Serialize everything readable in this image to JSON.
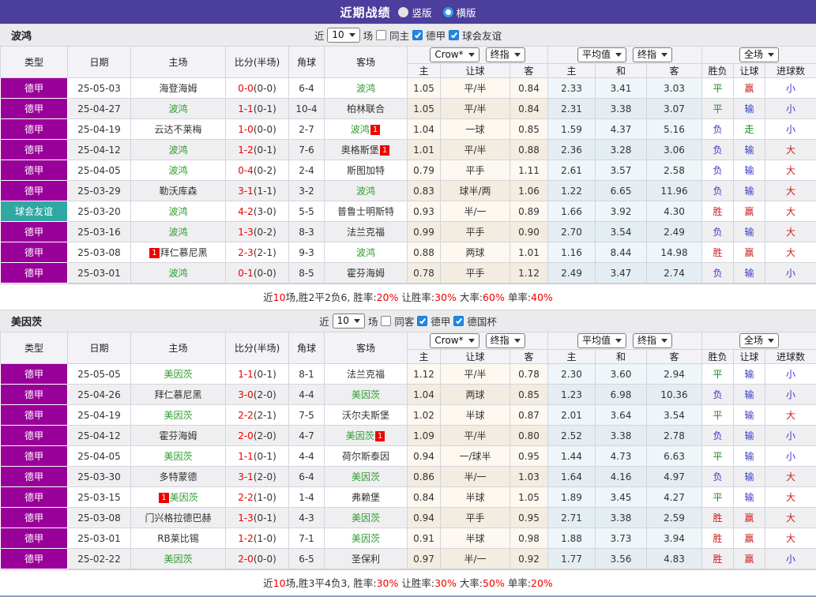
{
  "title_bar": {
    "title": "近期战绩",
    "radios": [
      {
        "label": "竖版",
        "checked": false
      },
      {
        "label": "横版",
        "checked": true
      }
    ]
  },
  "table_header": {
    "static_cols": [
      "类型",
      "日期",
      "主场",
      "比分(半场)",
      "角球",
      "客场"
    ],
    "selects": {
      "company": "Crow*",
      "stage": "终指",
      "average": "平均值",
      "average_stage": "终指",
      "scope": "全场"
    },
    "odds_cols": [
      "主",
      "让球",
      "客"
    ],
    "avg_cols": [
      "主",
      "和",
      "客"
    ],
    "result_cols": [
      "胜负",
      "让球",
      "进球数"
    ]
  },
  "redcard_badge": "1",
  "sections": [
    {
      "team": "波鸿",
      "filter": {
        "near": "近",
        "count": "10",
        "games": "场",
        "same": {
          "label": "同主",
          "checked": false
        },
        "leagues": [
          {
            "label": "德甲",
            "checked": true
          },
          {
            "label": "球会友谊",
            "checked": true
          }
        ]
      },
      "rows": [
        {
          "league": "德甲",
          "badge": "purple",
          "date": "25-05-03",
          "home": {
            "name": "海登海姆",
            "green": false,
            "rc": false
          },
          "score": "0-0",
          "half": "(0-0)",
          "corner": "6-4",
          "away": {
            "name": "波鸿",
            "green": true,
            "rc": false
          },
          "odds": [
            "1.05",
            "平/半",
            "0.84",
            "2.33",
            "3.41",
            "3.03"
          ],
          "results": [
            [
              "平",
              "g"
            ],
            [
              "赢",
              "r"
            ],
            [
              "小",
              "b"
            ]
          ]
        },
        {
          "league": "德甲",
          "badge": "purple",
          "date": "25-04-27",
          "home": {
            "name": "波鸿",
            "green": true,
            "rc": false
          },
          "score": "1-1",
          "half": "(0-1)",
          "corner": "10-4",
          "away": {
            "name": "柏林联合",
            "green": false,
            "rc": false
          },
          "odds": [
            "1.05",
            "平/半",
            "0.84",
            "2.31",
            "3.38",
            "3.07"
          ],
          "results": [
            [
              "平",
              "g"
            ],
            [
              "输",
              "b"
            ],
            [
              "小",
              "b"
            ]
          ]
        },
        {
          "league": "德甲",
          "badge": "purple",
          "date": "25-04-19",
          "home": {
            "name": "云达不莱梅",
            "green": false,
            "rc": false
          },
          "score": "1-0",
          "half": "(0-0)",
          "corner": "2-7",
          "away": {
            "name": "波鸿",
            "green": true,
            "rc": true
          },
          "odds": [
            "1.04",
            "一球",
            "0.85",
            "1.59",
            "4.37",
            "5.16"
          ],
          "results": [
            [
              "负",
              "b"
            ],
            [
              "走",
              "g"
            ],
            [
              "小",
              "b"
            ]
          ]
        },
        {
          "league": "德甲",
          "badge": "purple",
          "date": "25-04-12",
          "home": {
            "name": "波鸿",
            "green": true,
            "rc": false
          },
          "score": "1-2",
          "half": "(0-1)",
          "corner": "7-6",
          "away": {
            "name": "奥格斯堡",
            "green": false,
            "rc": true
          },
          "odds": [
            "1.01",
            "平/半",
            "0.88",
            "2.36",
            "3.28",
            "3.06"
          ],
          "results": [
            [
              "负",
              "b"
            ],
            [
              "输",
              "b"
            ],
            [
              "大",
              "r"
            ]
          ]
        },
        {
          "league": "德甲",
          "badge": "purple",
          "date": "25-04-05",
          "home": {
            "name": "波鸿",
            "green": true,
            "rc": false
          },
          "score": "0-4",
          "half": "(0-2)",
          "corner": "2-4",
          "away": {
            "name": "斯图加特",
            "green": false,
            "rc": false
          },
          "odds": [
            "0.79",
            "平手",
            "1.11",
            "2.61",
            "3.57",
            "2.58"
          ],
          "results": [
            [
              "负",
              "b"
            ],
            [
              "输",
              "b"
            ],
            [
              "大",
              "r"
            ]
          ]
        },
        {
          "league": "德甲",
          "badge": "purple",
          "date": "25-03-29",
          "home": {
            "name": "勒沃库森",
            "green": false,
            "rc": false
          },
          "score": "3-1",
          "half": "(1-1)",
          "corner": "3-2",
          "away": {
            "name": "波鸿",
            "green": true,
            "rc": false
          },
          "odds": [
            "0.83",
            "球半/两",
            "1.06",
            "1.22",
            "6.65",
            "11.96"
          ],
          "results": [
            [
              "负",
              "b"
            ],
            [
              "输",
              "b"
            ],
            [
              "大",
              "r"
            ]
          ]
        },
        {
          "league": "球会友谊",
          "badge": "teal",
          "date": "25-03-20",
          "home": {
            "name": "波鸿",
            "green": true,
            "rc": false
          },
          "score": "4-2",
          "half": "(3-0)",
          "corner": "5-5",
          "away": {
            "name": "普鲁士明斯特",
            "green": false,
            "rc": false
          },
          "odds": [
            "0.93",
            "半/一",
            "0.89",
            "1.66",
            "3.92",
            "4.30"
          ],
          "results": [
            [
              "胜",
              "r"
            ],
            [
              "赢",
              "r"
            ],
            [
              "大",
              "r"
            ]
          ]
        },
        {
          "league": "德甲",
          "badge": "purple",
          "date": "25-03-16",
          "home": {
            "name": "波鸿",
            "green": true,
            "rc": false
          },
          "score": "1-3",
          "half": "(0-2)",
          "corner": "8-3",
          "away": {
            "name": "法兰克福",
            "green": false,
            "rc": false
          },
          "odds": [
            "0.99",
            "平手",
            "0.90",
            "2.70",
            "3.54",
            "2.49"
          ],
          "results": [
            [
              "负",
              "b"
            ],
            [
              "输",
              "b"
            ],
            [
              "大",
              "r"
            ]
          ]
        },
        {
          "league": "德甲",
          "badge": "purple",
          "date": "25-03-08",
          "home": {
            "name": "拜仁慕尼黑",
            "green": false,
            "rc": true
          },
          "score": "2-3",
          "half": "(2-1)",
          "corner": "9-3",
          "away": {
            "name": "波鸿",
            "green": true,
            "rc": false
          },
          "odds": [
            "0.88",
            "两球",
            "1.01",
            "1.16",
            "8.44",
            "14.98"
          ],
          "results": [
            [
              "胜",
              "r"
            ],
            [
              "赢",
              "r"
            ],
            [
              "大",
              "r"
            ]
          ]
        },
        {
          "league": "德甲",
          "badge": "purple",
          "date": "25-03-01",
          "home": {
            "name": "波鸿",
            "green": true,
            "rc": false
          },
          "score": "0-1",
          "half": "(0-0)",
          "corner": "8-5",
          "away": {
            "name": "霍芬海姆",
            "green": false,
            "rc": false
          },
          "odds": [
            "0.78",
            "平手",
            "1.12",
            "2.49",
            "3.47",
            "2.74"
          ],
          "results": [
            [
              "负",
              "b"
            ],
            [
              "输",
              "b"
            ],
            [
              "小",
              "b"
            ]
          ]
        }
      ],
      "summary": [
        [
          "近",
          "k"
        ],
        [
          "10",
          "r"
        ],
        [
          "场,胜2平2负6, 胜率:",
          "k"
        ],
        [
          "20%",
          "r"
        ],
        [
          " 让胜率:",
          "k"
        ],
        [
          "30%",
          "r"
        ],
        [
          " 大率:",
          "k"
        ],
        [
          "60%",
          "r"
        ],
        [
          " 单率:",
          "k"
        ],
        [
          "40%",
          "r"
        ]
      ]
    },
    {
      "team": "美因茨",
      "filter": {
        "near": "近",
        "count": "10",
        "games": "场",
        "same": {
          "label": "同客",
          "checked": false
        },
        "leagues": [
          {
            "label": "德甲",
            "checked": true
          },
          {
            "label": "德国杯",
            "checked": true
          }
        ]
      },
      "rows": [
        {
          "league": "德甲",
          "badge": "purple",
          "date": "25-05-05",
          "home": {
            "name": "美因茨",
            "green": true,
            "rc": false
          },
          "score": "1-1",
          "half": "(0-1)",
          "corner": "8-1",
          "away": {
            "name": "法兰克福",
            "green": false,
            "rc": false
          },
          "odds": [
            "1.12",
            "平/半",
            "0.78",
            "2.30",
            "3.60",
            "2.94"
          ],
          "results": [
            [
              "平",
              "g"
            ],
            [
              "输",
              "b"
            ],
            [
              "小",
              "b"
            ]
          ]
        },
        {
          "league": "德甲",
          "badge": "purple",
          "date": "25-04-26",
          "home": {
            "name": "拜仁慕尼黑",
            "green": false,
            "rc": false
          },
          "score": "3-0",
          "half": "(2-0)",
          "corner": "4-4",
          "away": {
            "name": "美因茨",
            "green": true,
            "rc": false
          },
          "odds": [
            "1.04",
            "两球",
            "0.85",
            "1.23",
            "6.98",
            "10.36"
          ],
          "results": [
            [
              "负",
              "b"
            ],
            [
              "输",
              "b"
            ],
            [
              "小",
              "b"
            ]
          ]
        },
        {
          "league": "德甲",
          "badge": "purple",
          "date": "25-04-19",
          "home": {
            "name": "美因茨",
            "green": true,
            "rc": false
          },
          "score": "2-2",
          "half": "(2-1)",
          "corner": "7-5",
          "away": {
            "name": "沃尔夫斯堡",
            "green": false,
            "rc": false
          },
          "odds": [
            "1.02",
            "半球",
            "0.87",
            "2.01",
            "3.64",
            "3.54"
          ],
          "results": [
            [
              "平",
              "g"
            ],
            [
              "输",
              "b"
            ],
            [
              "大",
              "r"
            ]
          ]
        },
        {
          "league": "德甲",
          "badge": "purple",
          "date": "25-04-12",
          "home": {
            "name": "霍芬海姆",
            "green": false,
            "rc": false
          },
          "score": "2-0",
          "half": "(2-0)",
          "corner": "4-7",
          "away": {
            "name": "美因茨",
            "green": true,
            "rc": true
          },
          "odds": [
            "1.09",
            "平/半",
            "0.80",
            "2.52",
            "3.38",
            "2.78"
          ],
          "results": [
            [
              "负",
              "b"
            ],
            [
              "输",
              "b"
            ],
            [
              "小",
              "b"
            ]
          ]
        },
        {
          "league": "德甲",
          "badge": "purple",
          "date": "25-04-05",
          "home": {
            "name": "美因茨",
            "green": true,
            "rc": false
          },
          "score": "1-1",
          "half": "(0-1)",
          "corner": "4-4",
          "away": {
            "name": "荷尔斯泰因",
            "green": false,
            "rc": false
          },
          "odds": [
            "0.94",
            "一/球半",
            "0.95",
            "1.44",
            "4.73",
            "6.63"
          ],
          "results": [
            [
              "平",
              "g"
            ],
            [
              "输",
              "b"
            ],
            [
              "小",
              "b"
            ]
          ]
        },
        {
          "league": "德甲",
          "badge": "purple",
          "date": "25-03-30",
          "home": {
            "name": "多特蒙德",
            "green": false,
            "rc": false
          },
          "score": "3-1",
          "half": "(2-0)",
          "corner": "6-4",
          "away": {
            "name": "美因茨",
            "green": true,
            "rc": false
          },
          "odds": [
            "0.86",
            "半/一",
            "1.03",
            "1.64",
            "4.16",
            "4.97"
          ],
          "results": [
            [
              "负",
              "b"
            ],
            [
              "输",
              "b"
            ],
            [
              "大",
              "r"
            ]
          ]
        },
        {
          "league": "德甲",
          "badge": "purple",
          "date": "25-03-15",
          "home": {
            "name": "美因茨",
            "green": true,
            "rc": true
          },
          "score": "2-2",
          "half": "(1-0)",
          "corner": "1-4",
          "away": {
            "name": "弗赖堡",
            "green": false,
            "rc": false
          },
          "odds": [
            "0.84",
            "半球",
            "1.05",
            "1.89",
            "3.45",
            "4.27"
          ],
          "results": [
            [
              "平",
              "g"
            ],
            [
              "输",
              "b"
            ],
            [
              "大",
              "r"
            ]
          ]
        },
        {
          "league": "德甲",
          "badge": "purple",
          "date": "25-03-08",
          "home": {
            "name": "门兴格拉德巴赫",
            "green": false,
            "rc": false
          },
          "score": "1-3",
          "half": "(0-1)",
          "corner": "4-3",
          "away": {
            "name": "美因茨",
            "green": true,
            "rc": false
          },
          "odds": [
            "0.94",
            "平手",
            "0.95",
            "2.71",
            "3.38",
            "2.59"
          ],
          "results": [
            [
              "胜",
              "r"
            ],
            [
              "赢",
              "r"
            ],
            [
              "大",
              "r"
            ]
          ]
        },
        {
          "league": "德甲",
          "badge": "purple",
          "date": "25-03-01",
          "home": {
            "name": "RB莱比锡",
            "green": false,
            "rc": false
          },
          "score": "1-2",
          "half": "(1-0)",
          "corner": "7-1",
          "away": {
            "name": "美因茨",
            "green": true,
            "rc": false
          },
          "odds": [
            "0.91",
            "半球",
            "0.98",
            "1.88",
            "3.73",
            "3.94"
          ],
          "results": [
            [
              "胜",
              "r"
            ],
            [
              "赢",
              "r"
            ],
            [
              "大",
              "r"
            ]
          ]
        },
        {
          "league": "德甲",
          "badge": "purple",
          "date": "25-02-22",
          "home": {
            "name": "美因茨",
            "green": true,
            "rc": false
          },
          "score": "2-0",
          "half": "(0-0)",
          "corner": "6-5",
          "away": {
            "name": "圣保利",
            "green": false,
            "rc": false
          },
          "odds": [
            "0.97",
            "半/一",
            "0.92",
            "1.77",
            "3.56",
            "4.83"
          ],
          "results": [
            [
              "胜",
              "r"
            ],
            [
              "赢",
              "r"
            ],
            [
              "小",
              "b"
            ]
          ]
        }
      ],
      "summary": [
        [
          "近",
          "k"
        ],
        [
          "10",
          "r"
        ],
        [
          "场,胜3平4负3, 胜率:",
          "k"
        ],
        [
          "30%",
          "r"
        ],
        [
          " 让胜率:",
          "k"
        ],
        [
          "30%",
          "r"
        ],
        [
          " 大率:",
          "k"
        ],
        [
          "50%",
          "r"
        ],
        [
          " 单率:",
          "k"
        ],
        [
          "20%",
          "r"
        ]
      ]
    }
  ]
}
